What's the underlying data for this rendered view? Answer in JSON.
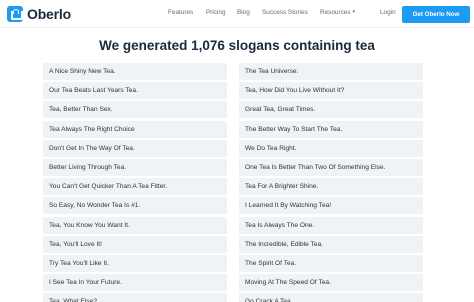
{
  "nav": {
    "brand": "Oberlo",
    "links": {
      "features": "Features",
      "pricing": "Pricing",
      "blog": "Blog",
      "success_stories": "Success Stories",
      "resources": "Resources",
      "login": "Login"
    },
    "cta": "Get Oberlo Now",
    "accent_color": "#1b9cf2"
  },
  "title": "We generated 1,076 slogans containing tea",
  "slogans": {
    "left": [
      "A Nice Shiny New Tea.",
      "Our Tea Beats Last Years Tea.",
      "Tea, Better Than Sex.",
      "Tea Always The Right Choice",
      "Don't Get In The Way Of Tea.",
      "Better Living Through Tea.",
      "You Can't Get Quicker Than A Tea Fitter.",
      "So Easy, No Wonder Tea Is #1.",
      "Tea, You Know You Want It.",
      "Tea, You'll Love It!",
      "Try Tea You'll Like It.",
      "I See Tea In Your Future.",
      "Tea, What Else?"
    ],
    "right": [
      "The Tea Universe.",
      "Tea, How Did You Live Without It?",
      "Great Tea, Great Times.",
      "The Better Way To Start The Tea.",
      "We Do Tea Right.",
      "One Tea Is Better Than Two Of Something Else.",
      "Tea For A Brighter Shine.",
      "I Learned It By Watching Tea!",
      "Tea Is Always The One.",
      "The Incredible, Edible Tea.",
      "The Spirit Of Tea.",
      "Moving At The Speed Of Tea.",
      "Go Crack A Tea."
    ]
  }
}
